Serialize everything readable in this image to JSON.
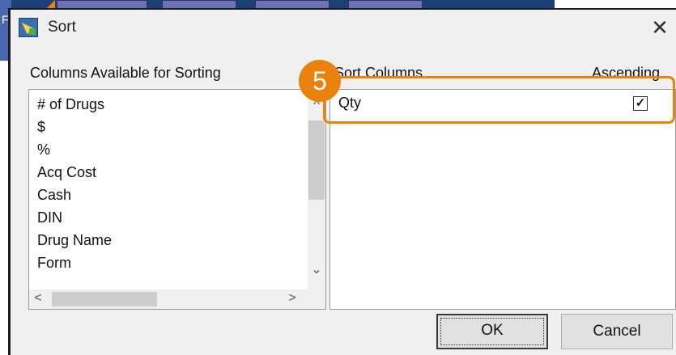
{
  "window": {
    "title": "Sort",
    "close_glyph": "✕",
    "icon": "sort-app-icon"
  },
  "background": {
    "side_letter": "F"
  },
  "available": {
    "label": "Columns Available for Sorting",
    "items": [
      "# of Drugs",
      "$",
      "%",
      "Acq Cost",
      "Cash",
      "DIN",
      "Drug Name",
      "Form"
    ],
    "scroll_up": "^",
    "scroll_down": "⌄",
    "scroll_left": "<",
    "scroll_right": ">"
  },
  "sort": {
    "label": "Sort Columns",
    "ascending_label": "Ascending",
    "items": [
      {
        "name": "Qty",
        "ascending": true,
        "check_glyph": "✓"
      }
    ]
  },
  "annotation": {
    "step": "5",
    "color": "#e8820c"
  },
  "buttons": {
    "ok": "OK",
    "cancel": "Cancel"
  }
}
